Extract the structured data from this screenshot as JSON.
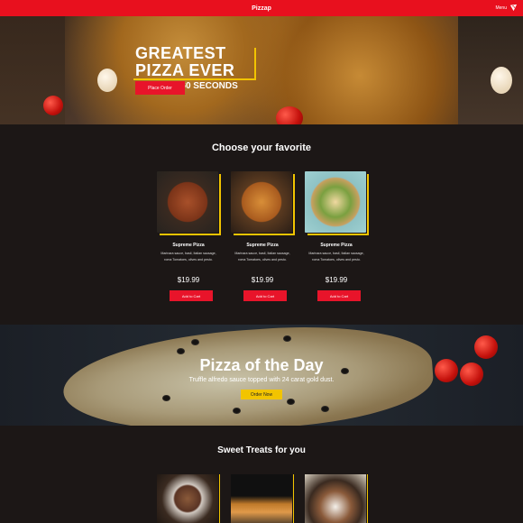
{
  "header": {
    "brand": "Pizzap",
    "menu_label": "Menu",
    "menu_icon": "pizza-slice-icon",
    "accent": "#e8101e"
  },
  "hero": {
    "title_line1": "GREATEST",
    "title_line2": "PIZZA EVER",
    "subtitle": "READY IN 60 SECONDS",
    "button": "Place Order",
    "frame_color": "#f2c400"
  },
  "favorites": {
    "title": "Choose your favorite",
    "cards": [
      {
        "name": "Supreme Pizza",
        "description": "Marinara sauce, basil, Italian sausage, roma Tomatoes, olives and pesto.",
        "price": "$19.99",
        "button": "Add to Cart"
      },
      {
        "name": "Supreme Pizza",
        "description": "Marinara sauce, basil, Italian sausage, roma Tomatoes, olives and pesto.",
        "price": "$19.99",
        "button": "Add to Cart"
      },
      {
        "name": "Supreme Pizza",
        "description": "Marinara sauce, basil, Italian sausage, roma Tomatoes, olives and pesto.",
        "price": "$19.99",
        "button": "Add to Cart"
      }
    ]
  },
  "pizza_of_the_day": {
    "title": "Pizza of the Day",
    "subtitle": "Truffle alfredo sauce topped with 24 carat gold dust.",
    "button": "Order Now",
    "button_color": "#f2c400"
  },
  "sweet_treats": {
    "title": "Sweet Treats for you"
  }
}
